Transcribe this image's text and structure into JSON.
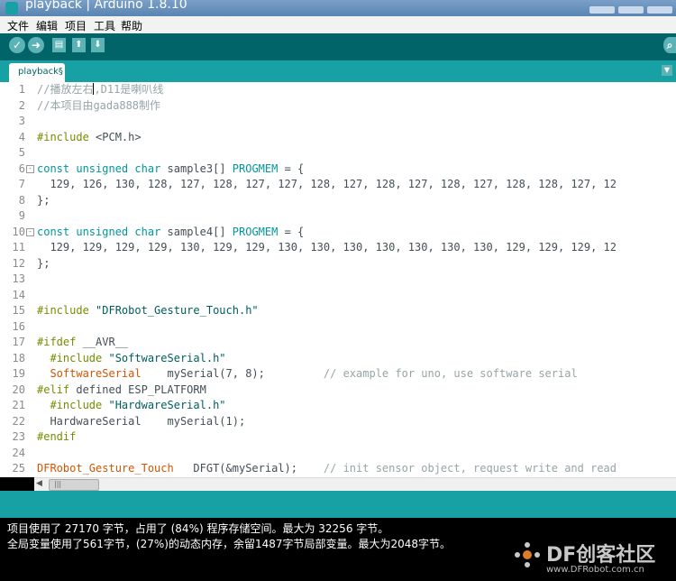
{
  "window": {
    "title": "playback | Arduino 1.8.10"
  },
  "menu": [
    "文件",
    "编辑",
    "项目",
    "工具",
    "帮助"
  ],
  "toolbar": {
    "verify_icon": "check-icon",
    "upload_icon": "arrow-right-icon",
    "new_icon": "file-icon",
    "open_icon": "arrow-up-icon",
    "save_icon": "arrow-down-icon",
    "verify_glyph": "✓",
    "upload_glyph": "➜",
    "new_glyph": "▤",
    "open_glyph": "⬆",
    "save_glyph": "⬇",
    "serial_glyph": "⌕",
    "tab_menu_glyph": "▼"
  },
  "tab": {
    "label": "playback§"
  },
  "editor": {
    "lines": [
      {
        "n": "1",
        "text": "//播放左右,D11是喇叭线"
      },
      {
        "n": "2",
        "text": "//本项目由gada888制作"
      },
      {
        "n": "3",
        "text": ""
      },
      {
        "n": "4",
        "text": "#include <PCM.h>"
      },
      {
        "n": "5",
        "text": ""
      },
      {
        "n": "6",
        "text": "const unsigned char sample3[] PROGMEM = {"
      },
      {
        "n": "7",
        "text": "  129, 126, 130, 128, 127, 128, 127, 127, 128, 127, 128, 127, 128, 127, 128, 128, 127, 12"
      },
      {
        "n": "8",
        "text": "};"
      },
      {
        "n": "9",
        "text": ""
      },
      {
        "n": "10",
        "text": "const unsigned char sample4[] PROGMEM = {"
      },
      {
        "n": "11",
        "text": "  129, 129, 129, 129, 130, 129, 129, 130, 130, 130, 130, 130, 130, 130, 129, 129, 129, 12"
      },
      {
        "n": "12",
        "text": "};"
      },
      {
        "n": "13",
        "text": ""
      },
      {
        "n": "14",
        "text": ""
      },
      {
        "n": "15",
        "text": "#include \"DFRobot_Gesture_Touch.h\""
      },
      {
        "n": "16",
        "text": ""
      },
      {
        "n": "17",
        "text": "#ifdef __AVR__"
      },
      {
        "n": "18",
        "text": "  #include \"SoftwareSerial.h\""
      },
      {
        "n": "19",
        "text": "  SoftwareSerial    mySerial(7, 8);         // example for uno, use software serial"
      },
      {
        "n": "20",
        "text": "#elif defined ESP_PLATFORM"
      },
      {
        "n": "21",
        "text": "  #include \"HardwareSerial.h\""
      },
      {
        "n": "22",
        "text": "  HardwareSerial    mySerial(1);"
      },
      {
        "n": "23",
        "text": "#endif"
      },
      {
        "n": "24",
        "text": ""
      },
      {
        "n": "25",
        "text": "DFRobot_Gesture_Touch   DFGT(&mySerial);    // init sensor object, request write and read"
      }
    ],
    "tokens": {
      "line1_comment_a": "//播放左右",
      "line1_comment_b": ",D11是喇叭线",
      "line2_comment": "//本项目由gada888制作",
      "hash_include": "#include",
      "pcm_header": " <PCM.h>",
      "const_kw": "const",
      "unsigned_kw": "unsigned",
      "char_kw": "char",
      "sample3_decl": " sample3[] ",
      "sample4_decl": " sample4[] ",
      "progmem_kw": "PROGMEM",
      "assign_brace": " = {",
      "data7": "  129, 126, 130, 128, 127, 128, 127, 127, 128, 127, 128, 127, 128, 127, 128, 128, 127, 12",
      "data11": "  129, 129, 129, 129, 130, 129, 129, 130, 130, 130, 130, 130, 130, 130, 129, 129, 129, 12",
      "close_brace": "};",
      "gesture_header_str": " \"DFRobot_Gesture_Touch.h\"",
      "ifdef_kw": "#ifdef",
      "avr_macro": " __AVR__",
      "include_indented": "  #include",
      "softserial_str": " \"SoftwareSerial.h\"",
      "softserial_type": "SoftwareSerial",
      "softserial_rest": "    mySerial(7, 8);         ",
      "uno_comment": "// example for uno, use software serial",
      "elif_kw": "#elif",
      "esp_rest": " defined ESP_PLATFORM",
      "hwserial_str": " \"HardwareSerial.h\"",
      "hwserial_line": "  HardwareSerial    mySerial(1);",
      "endif_kw": "#endif",
      "dfrobot_type": "DFRobot_Gesture_Touch",
      "dfgt_rest": "   DFGT(&mySerial);    ",
      "init_comment": "// init sensor object, request write and read"
    }
  },
  "scrollbar": {
    "left_arrow": "◀",
    "grip": "|||"
  },
  "console": {
    "line1": "项目使用了 27170 字节，占用了 (84%) 程序存储空间。最大为 32256 字节。",
    "line2": "全局变量使用了561字节，(27%)的动态内存，余留1487字节局部变量。最大为2048字节。"
  },
  "watermark": {
    "text": "DF创客社区",
    "url": "www.DFRobot.com.cn"
  },
  "colors": {
    "toolbar": "#006468",
    "tabbar": "#17a1a5",
    "comment": "#95a5a6",
    "keyword": "#00979c",
    "preprocessor": "#728e00",
    "type": "#d35400"
  }
}
